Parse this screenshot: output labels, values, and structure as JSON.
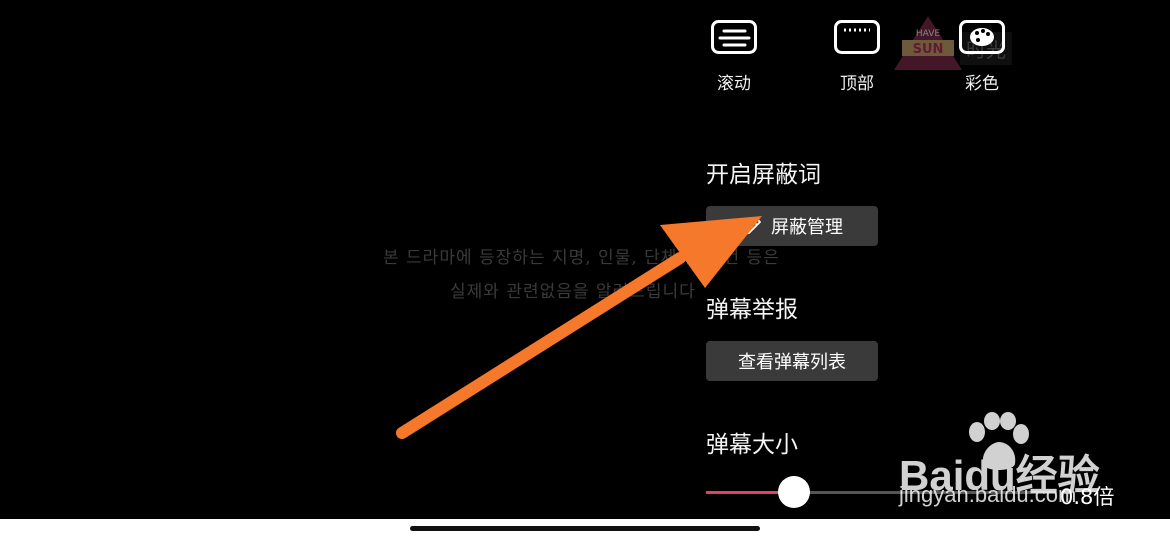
{
  "background_subtitle": {
    "line1": "본 드라마에 등장하는 지명, 인물, 단체 및 사건 등은",
    "line2": "실제와 관련없음을 알려드립니다"
  },
  "watermark_top": {
    "text": "时光"
  },
  "danmaku_modes": [
    {
      "label": "滚动",
      "icon": "scroll-mode-icon"
    },
    {
      "label": "顶部",
      "icon": "top-mode-icon"
    },
    {
      "label": "彩色",
      "icon": "palette-icon"
    }
  ],
  "block_words": {
    "title": "开启屏蔽词",
    "button_label": "屏蔽管理",
    "button_icon": "pencil-icon"
  },
  "report": {
    "title": "弹幕举报",
    "button_label": "查看弹幕列表"
  },
  "size": {
    "title": "弹幕大小",
    "value_label": "0.8倍",
    "level_fraction": 0.25
  },
  "watermark_baidu": {
    "logo": "Baidu经验",
    "url": "jingyan.baidu.com"
  },
  "colors": {
    "accent": "#e0416b",
    "arrow": "#f5782b",
    "button_bg": "#3a3a3a"
  }
}
